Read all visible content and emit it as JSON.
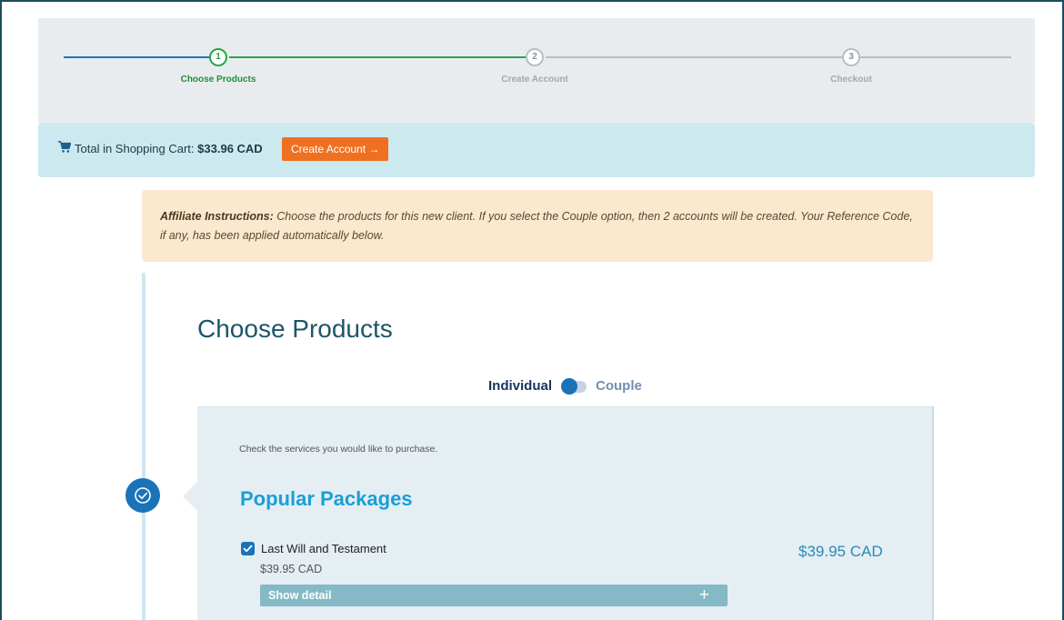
{
  "stepper": {
    "steps": [
      {
        "number": "1",
        "label": "Choose Products"
      },
      {
        "number": "2",
        "label": "Create Account"
      },
      {
        "number": "3",
        "label": "Checkout"
      }
    ]
  },
  "cart": {
    "icon": "shopping-cart-icon",
    "label": "Total in Shopping Cart:",
    "total": "$33.96 CAD",
    "button_label": "Create Account →"
  },
  "affiliate": {
    "heading": "Affiliate Instructions:",
    "text": "Choose the products for this new client. If you select the Couple option, then 2 accounts will be created. Your Reference Code, if any, has been applied automatically below."
  },
  "main": {
    "title": "Choose Products",
    "toggle": {
      "left_label": "Individual",
      "right_label": "Couple",
      "selected": "Individual"
    },
    "hint": "Check the services you would like to purchase.",
    "section_title": "Popular Packages",
    "items": [
      {
        "name": "Last Will and Testament",
        "price_small": "$39.95 CAD",
        "price": "$39.95 CAD",
        "checked": true,
        "detail_label": "Show detail",
        "detail_icon": "plus-icon"
      }
    ]
  },
  "colors": {
    "accent": "#1a73b8",
    "orange": "#f07022",
    "green": "#28a745"
  }
}
